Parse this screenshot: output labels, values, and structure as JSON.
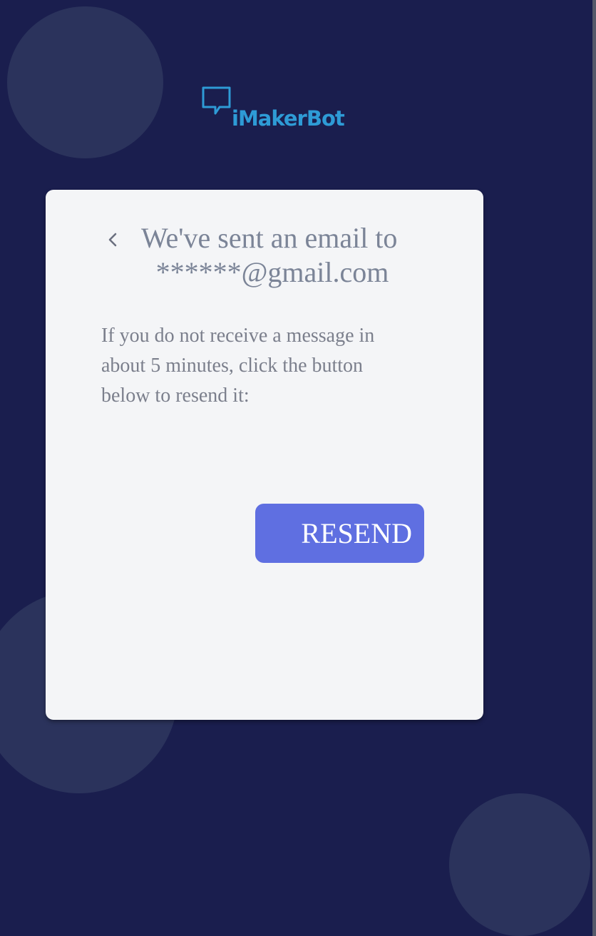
{
  "brand": {
    "name": "iMakerBot",
    "logo_icon": "chat-bubble-icon",
    "color": "#2e9bd6"
  },
  "card": {
    "back_icon": "chevron-left-icon",
    "heading_line1": "We've sent an email to",
    "heading_line2": "******@gmail.com",
    "message": "If you do not receive a message in about 5 minutes, click the button below to resend it:",
    "resend_label": "RESEND"
  },
  "colors": {
    "background": "#1a1e4e",
    "bubble": "#2b335c",
    "card": "#f4f5f7",
    "text": "#7b8497",
    "accent": "#5f6fe1"
  }
}
